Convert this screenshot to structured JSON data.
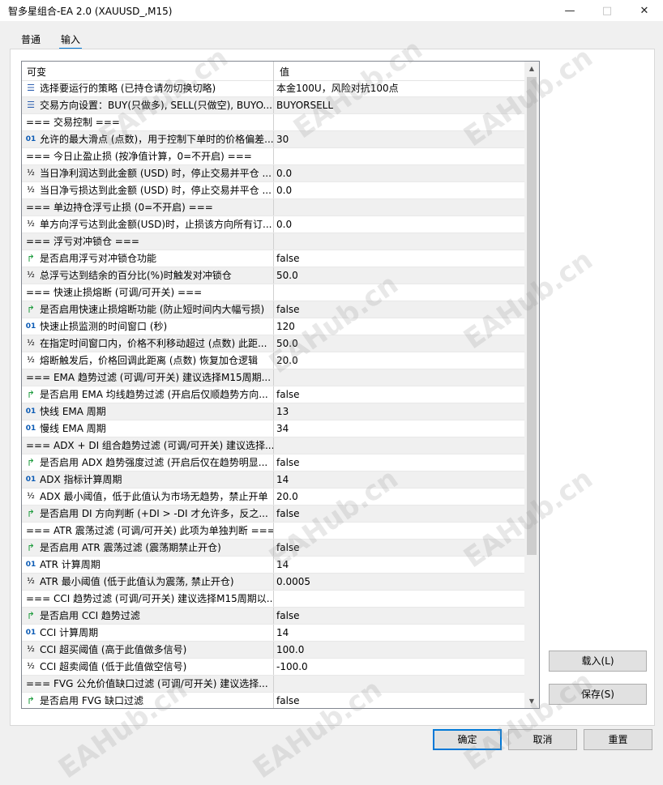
{
  "window": {
    "title": "智多星组合-EA 2.0 (XAUUSD_,M15)"
  },
  "tabs": [
    {
      "label": "普通"
    },
    {
      "label": "输入"
    }
  ],
  "grid": {
    "headers": {
      "name": "可变",
      "value": "值"
    },
    "rows": [
      {
        "name": "选择要运行的策略 (已持仓请勿切换切略)",
        "value": "本金100U，风险对抗100点",
        "type": "list"
      },
      {
        "name": "交易方向设置：BUY(只做多), SELL(只做空), BUYO...",
        "value": "BUYORSELL",
        "type": "list"
      },
      {
        "name": "=== 交易控制 ===",
        "value": "",
        "type": "section"
      },
      {
        "name": "允许的最大滑点 (点数)，用于控制下单时的价格偏差...",
        "value": "30",
        "type": "int"
      },
      {
        "name": "=== 今日止盈止损 (按净值计算，0=不开启) ===",
        "value": "",
        "type": "section"
      },
      {
        "name": "当日净利润达到此金额 (USD) 时，停止交易并平仓 ...",
        "value": "0.0",
        "type": "double"
      },
      {
        "name": "当日净亏损达到此金额 (USD) 时，停止交易并平仓 ...",
        "value": "0.0",
        "type": "double"
      },
      {
        "name": "=== 单边持仓浮亏止损 (0=不开启) ===",
        "value": "",
        "type": "section"
      },
      {
        "name": "单方向浮亏达到此金额(USD)时，止损该方向所有订...",
        "value": "0.0",
        "type": "double"
      },
      {
        "name": "=== 浮亏对冲锁仓 ===",
        "value": "",
        "type": "section"
      },
      {
        "name": "是否启用浮亏对冲锁仓功能",
        "value": "false",
        "type": "bool"
      },
      {
        "name": "总浮亏达到结余的百分比(%)时触发对冲锁仓",
        "value": "50.0",
        "type": "double"
      },
      {
        "name": "=== 快速止损熔断 (可调/可开关) ===",
        "value": "",
        "type": "section"
      },
      {
        "name": "是否启用快速止损熔断功能 (防止短时间内大幅亏损)",
        "value": "false",
        "type": "bool"
      },
      {
        "name": "快速止损监测的时间窗口 (秒)",
        "value": "120",
        "type": "int"
      },
      {
        "name": "在指定时间窗口内，价格不利移动超过 (点数) 此距...",
        "value": "50.0",
        "type": "double"
      },
      {
        "name": "熔断触发后，价格回调此距离 (点数) 恢复加仓逻辑",
        "value": "20.0",
        "type": "double"
      },
      {
        "name": "===  EMA 趋势过滤 (可调/可开关) 建议选择M15周期...",
        "value": "",
        "type": "section"
      },
      {
        "name": "是否启用 EMA 均线趋势过滤 (开启后仅顺趋势方向...",
        "value": "false",
        "type": "bool"
      },
      {
        "name": "快线 EMA 周期",
        "value": "13",
        "type": "int"
      },
      {
        "name": "慢线 EMA 周期",
        "value": "34",
        "type": "int"
      },
      {
        "name": "=== ADX + DI 组合趋势过滤 (可调/可开关) 建议选择...",
        "value": "",
        "type": "section"
      },
      {
        "name": "是否启用 ADX 趋势强度过滤 (开启后仅在趋势明显...",
        "value": "false",
        "type": "bool"
      },
      {
        "name": "ADX 指标计算周期",
        "value": "14",
        "type": "int"
      },
      {
        "name": "ADX 最小阈值，低于此值认为市场无趋势，禁止开单",
        "value": "20.0",
        "type": "double"
      },
      {
        "name": "是否启用 DI 方向判断 (+DI > -DI 才允许多，反之...",
        "value": "false",
        "type": "bool"
      },
      {
        "name": "=== ATR 震荡过滤 (可调/可开关) 此项为单独判断 ===",
        "value": "",
        "type": "section"
      },
      {
        "name": "是否启用 ATR 震荡过滤 (震荡期禁止开仓)",
        "value": "false",
        "type": "bool"
      },
      {
        "name": "ATR 计算周期",
        "value": "14",
        "type": "int"
      },
      {
        "name": "ATR 最小阈值 (低于此值认为震荡, 禁止开仓)",
        "value": "0.0005",
        "type": "double"
      },
      {
        "name": "=== CCI 趋势过滤 (可调/可开关) 建议选择M15周期以...",
        "value": "",
        "type": "section"
      },
      {
        "name": "是否启用 CCI 趋势过滤",
        "value": "false",
        "type": "bool"
      },
      {
        "name": "CCI 计算周期",
        "value": "14",
        "type": "int"
      },
      {
        "name": "CCI 超买阈值 (高于此值做多信号)",
        "value": "100.0",
        "type": "double"
      },
      {
        "name": "CCI 超卖阈值 (低于此值做空信号)",
        "value": "-100.0",
        "type": "double"
      },
      {
        "name": "=== FVG 公允价值缺口过滤 (可调/可开关) 建议选择...",
        "value": "",
        "type": "section"
      },
      {
        "name": "是否启用 FVG 缺口过滤",
        "value": "false",
        "type": "bool"
      }
    ]
  },
  "buttons": {
    "load": "载入(L)",
    "save": "保存(S)",
    "ok": "确定",
    "cancel": "取消",
    "reset": "重置"
  },
  "watermark": {
    "text": "EAHub.cn"
  },
  "icons": {
    "list": "list-icon",
    "int": "integer-icon",
    "double": "double-icon",
    "bool": "bool-icon"
  },
  "colors": {
    "accent": "#0078d7"
  }
}
